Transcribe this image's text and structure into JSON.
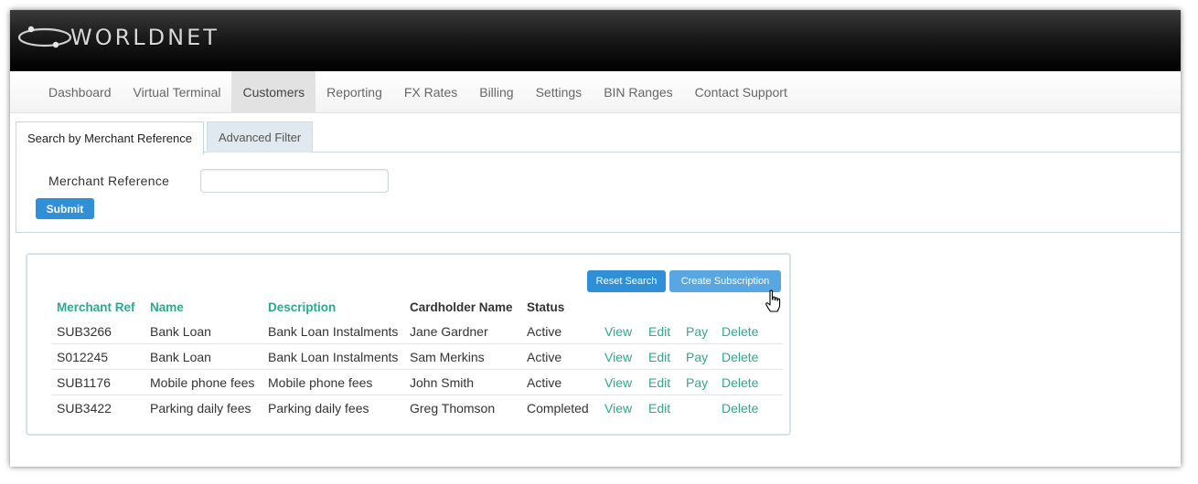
{
  "brand": {
    "name": "WORLDNET"
  },
  "nav": {
    "items": [
      {
        "label": "Dashboard",
        "active": false
      },
      {
        "label": "Virtual Terminal",
        "active": false
      },
      {
        "label": "Customers",
        "active": true
      },
      {
        "label": "Reporting",
        "active": false
      },
      {
        "label": "FX Rates",
        "active": false
      },
      {
        "label": "Billing",
        "active": false
      },
      {
        "label": "Settings",
        "active": false
      },
      {
        "label": "BIN Ranges",
        "active": false
      },
      {
        "label": "Contact Support",
        "active": false
      }
    ]
  },
  "tabs": [
    {
      "label": "Search by Merchant Reference",
      "active": true
    },
    {
      "label": "Advanced Filter",
      "active": false
    }
  ],
  "search": {
    "field_label": "Merchant Reference",
    "field_value": "",
    "submit_label": "Submit"
  },
  "results": {
    "reset_label": "Reset Search",
    "create_label": "Create Subscription",
    "columns": [
      "Merchant Ref",
      "Name",
      "Description",
      "Cardholder Name",
      "Status"
    ],
    "rows": [
      {
        "ref": "SUB3266",
        "name": "Bank Loan",
        "description": "Bank Loan Instalments",
        "cardholder": "Jane Gardner",
        "status": "Active",
        "view": "View",
        "edit": "Edit",
        "pay": "Pay",
        "delete": "Delete"
      },
      {
        "ref": "S012245",
        "name": "Bank Loan",
        "description": "Bank Loan Instalments",
        "cardholder": "Sam Merkins",
        "status": "Active",
        "view": "View",
        "edit": "Edit",
        "pay": "Pay",
        "delete": "Delete"
      },
      {
        "ref": "SUB1176",
        "name": "Mobile phone fees",
        "description": "Mobile phone fees",
        "cardholder": "John Smith",
        "status": "Active",
        "view": "View",
        "edit": "Edit",
        "pay": "Pay",
        "delete": "Delete"
      },
      {
        "ref": "SUB3422",
        "name": "Parking daily fees",
        "description": "Parking daily fees",
        "cardholder": "Greg Thomson",
        "status": "Completed",
        "view": "View",
        "edit": "Edit",
        "pay": "",
        "delete": "Delete"
      }
    ]
  },
  "colors": {
    "accent_teal": "#2baa8c",
    "button_blue": "#2f8fd7",
    "button_light_blue": "#59a7e2"
  },
  "icons": {
    "logo": "orbit-ring-icon",
    "cursor": "hand-pointer-icon"
  }
}
